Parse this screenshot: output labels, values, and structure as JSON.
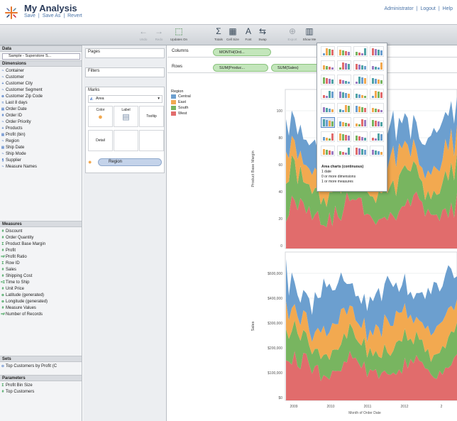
{
  "header": {
    "title": "My Analysis",
    "links": [
      "Save",
      "|",
      "Save As",
      "|",
      "Revert"
    ],
    "user_links": [
      "Administrator",
      "|",
      "Logout",
      "|",
      "Help"
    ]
  },
  "toolbar": {
    "undo": "Undo",
    "redo": "Redo",
    "update": "Updates On",
    "totals": "Totals",
    "cell_size": "Cell Size",
    "font": "Font",
    "swap": "Swap",
    "export": "Export",
    "show_me": "Show Me"
  },
  "data_pane": {
    "data_header": "Data",
    "datasource": "Sample - Superstore S...",
    "dimensions_header": "Dimensions",
    "dimensions": [
      {
        "icon": "~",
        "label": "Container"
      },
      {
        "icon": "~",
        "label": "Customer"
      },
      {
        "icon": "+",
        "label": "Customer City"
      },
      {
        "icon": "~",
        "label": "Customer Segment"
      },
      {
        "icon": "⊕",
        "label": "Customer Zip Code"
      },
      {
        "icon": "≈",
        "label": "Last 8 days"
      },
      {
        "icon": "▦",
        "label": "Order Date"
      },
      {
        "icon": "#",
        "label": "Order ID"
      },
      {
        "icon": "~",
        "label": "Order Priority"
      },
      {
        "icon": "+",
        "label": "Products"
      },
      {
        "icon": "▦",
        "label": "Profit (bin)"
      },
      {
        "icon": "~",
        "label": "Region"
      },
      {
        "icon": "▦",
        "label": "Ship Date"
      },
      {
        "icon": "~",
        "label": "Ship Mode"
      },
      {
        "icon": "§",
        "label": "Supplier"
      },
      {
        "icon": "~",
        "label": "Measure Names"
      }
    ],
    "measures_header": "Measures",
    "measures": [
      {
        "icon": "#",
        "label": "Discount"
      },
      {
        "icon": "#",
        "label": "Order Quantity"
      },
      {
        "icon": "Σ",
        "label": "Product Base Margin"
      },
      {
        "icon": "#",
        "label": "Profit"
      },
      {
        "icon": "=#",
        "label": "Profit Ratio"
      },
      {
        "icon": "Σ",
        "label": "Row ID"
      },
      {
        "icon": "#",
        "label": "Sales"
      },
      {
        "icon": "#",
        "label": "Shipping Cost"
      },
      {
        "icon": "=Σ",
        "label": "Time to Ship"
      },
      {
        "icon": "#",
        "label": "Unit Price"
      },
      {
        "icon": "⊕",
        "label": "Latitude (generated)"
      },
      {
        "icon": "⊕",
        "label": "Longitude (generated)"
      },
      {
        "icon": "#",
        "label": "Measure Values"
      },
      {
        "icon": "=#",
        "label": "Number of Records"
      }
    ],
    "sets_header": "Sets",
    "sets": [
      {
        "icon": "⊙",
        "label": "Top Customers by Profit (C"
      }
    ],
    "parameters_header": "Parameters",
    "parameters": [
      {
        "icon": "Σ",
        "label": "Profit Bin Size"
      },
      {
        "icon": "#",
        "label": "Top Customers"
      }
    ]
  },
  "shelves": {
    "pages": "Pages",
    "filters": "Filters",
    "marks": "Marks",
    "mark_type": "Area",
    "color": "Color",
    "label": "Label",
    "tooltip": "Tooltip",
    "detail": "Detail",
    "color_pill": "Region",
    "columns_label": "Columns",
    "rows_label": "Rows",
    "columns_pill": "MONTH(Ord...",
    "rows_pills": [
      "SUM(Produc...",
      "SUM(Sales)"
    ]
  },
  "legend": {
    "title": "Region",
    "items": [
      {
        "label": "Central",
        "color": "#6c9fcf"
      },
      {
        "label": "East",
        "color": "#f2a950"
      },
      {
        "label": "South",
        "color": "#78b560"
      },
      {
        "label": "West",
        "color": "#e16c6c"
      }
    ]
  },
  "show_me": {
    "desc_title": "Area charts (continuous)",
    "desc_lines": [
      "1 date",
      "0 or more dimensions",
      "1 or more measures"
    ]
  },
  "chart_data": {
    "type": "area",
    "xlabel": "Month of Order Date",
    "x_ticks": [
      "2009",
      "2010",
      "2011",
      "2012",
      "2"
    ],
    "panels": [
      {
        "ylabel": "Product Base Margin",
        "y_ticks": [
          "100",
          "80",
          "60",
          "40",
          "20",
          "0"
        ]
      },
      {
        "ylabel": "Sales",
        "y_ticks": [
          "$600,000",
          "$400,000",
          "$300,000",
          "$200,000",
          "$100,000",
          "$0"
        ]
      }
    ]
  }
}
